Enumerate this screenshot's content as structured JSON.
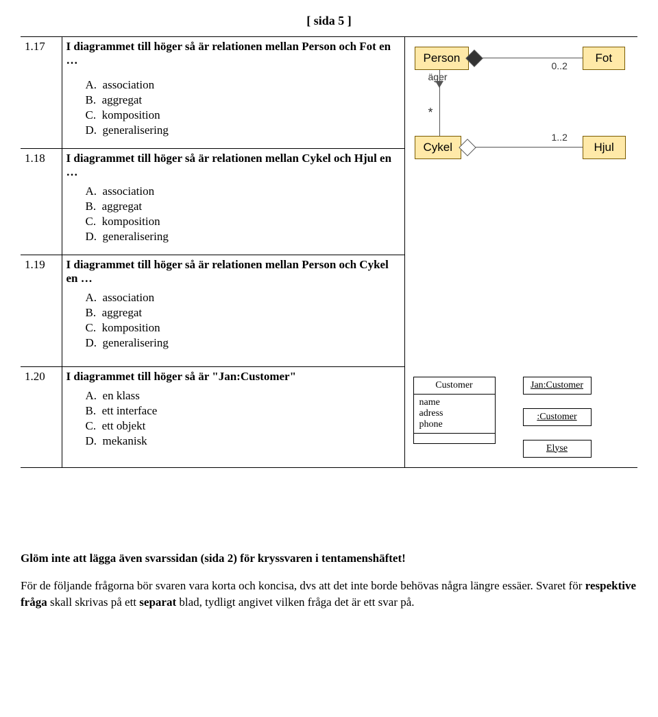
{
  "header": "[ sida 5 ]",
  "q117": {
    "num": "1.17",
    "text": "I diagrammet till höger så är relationen mellan Person och Fot en …",
    "opts": {
      "A": "association",
      "B": "aggregat",
      "C": "komposition",
      "D": "generalisering"
    }
  },
  "q118": {
    "num": "1.18",
    "text": "I diagrammet till höger så är relationen mellan Cykel och Hjul en …",
    "opts": {
      "A": "association",
      "B": "aggregat",
      "C": "komposition",
      "D": "generalisering"
    }
  },
  "q119": {
    "num": "1.19",
    "text": "I diagrammet till höger så är relationen mellan Person och Cykel en …",
    "opts": {
      "A": "association",
      "B": "aggregat",
      "C": "komposition",
      "D": "generalisering"
    }
  },
  "q120": {
    "num": "1.20",
    "text": "I diagrammet till höger så är \"Jan:Customer\"",
    "opts": {
      "A": "en klass",
      "B": "ett interface",
      "C": "ett objekt",
      "D": "mekanisk"
    }
  },
  "uml": {
    "person": "Person",
    "fot": "Fot",
    "cykel": "Cykel",
    "hjul": "Hjul",
    "ager": "äger",
    "mult_02": "0..2",
    "mult_star": "*",
    "mult_12": "1..2"
  },
  "classfig": {
    "customer_title": "Customer",
    "attrs": {
      "name": "name",
      "adress": "adress",
      "phone": "phone"
    },
    "jan": "Jan:Customer",
    "cust_obj": ":Customer",
    "elyse": "Elyse"
  },
  "footer": {
    "line1": "Glöm inte att lägga även svarssidan (sida 2) för kryssvaren i tentamenshäftet!",
    "line2a": "För de följande frågorna bör svaren vara korta och koncisa, dvs att det inte borde behövas några längre essäer. Svaret för ",
    "line2b": "respektive fråga",
    "line2c": " skall skrivas på ett ",
    "line2d": "separat",
    "line2e": " blad, tydligt angivet vilken fråga det är ett svar på."
  }
}
